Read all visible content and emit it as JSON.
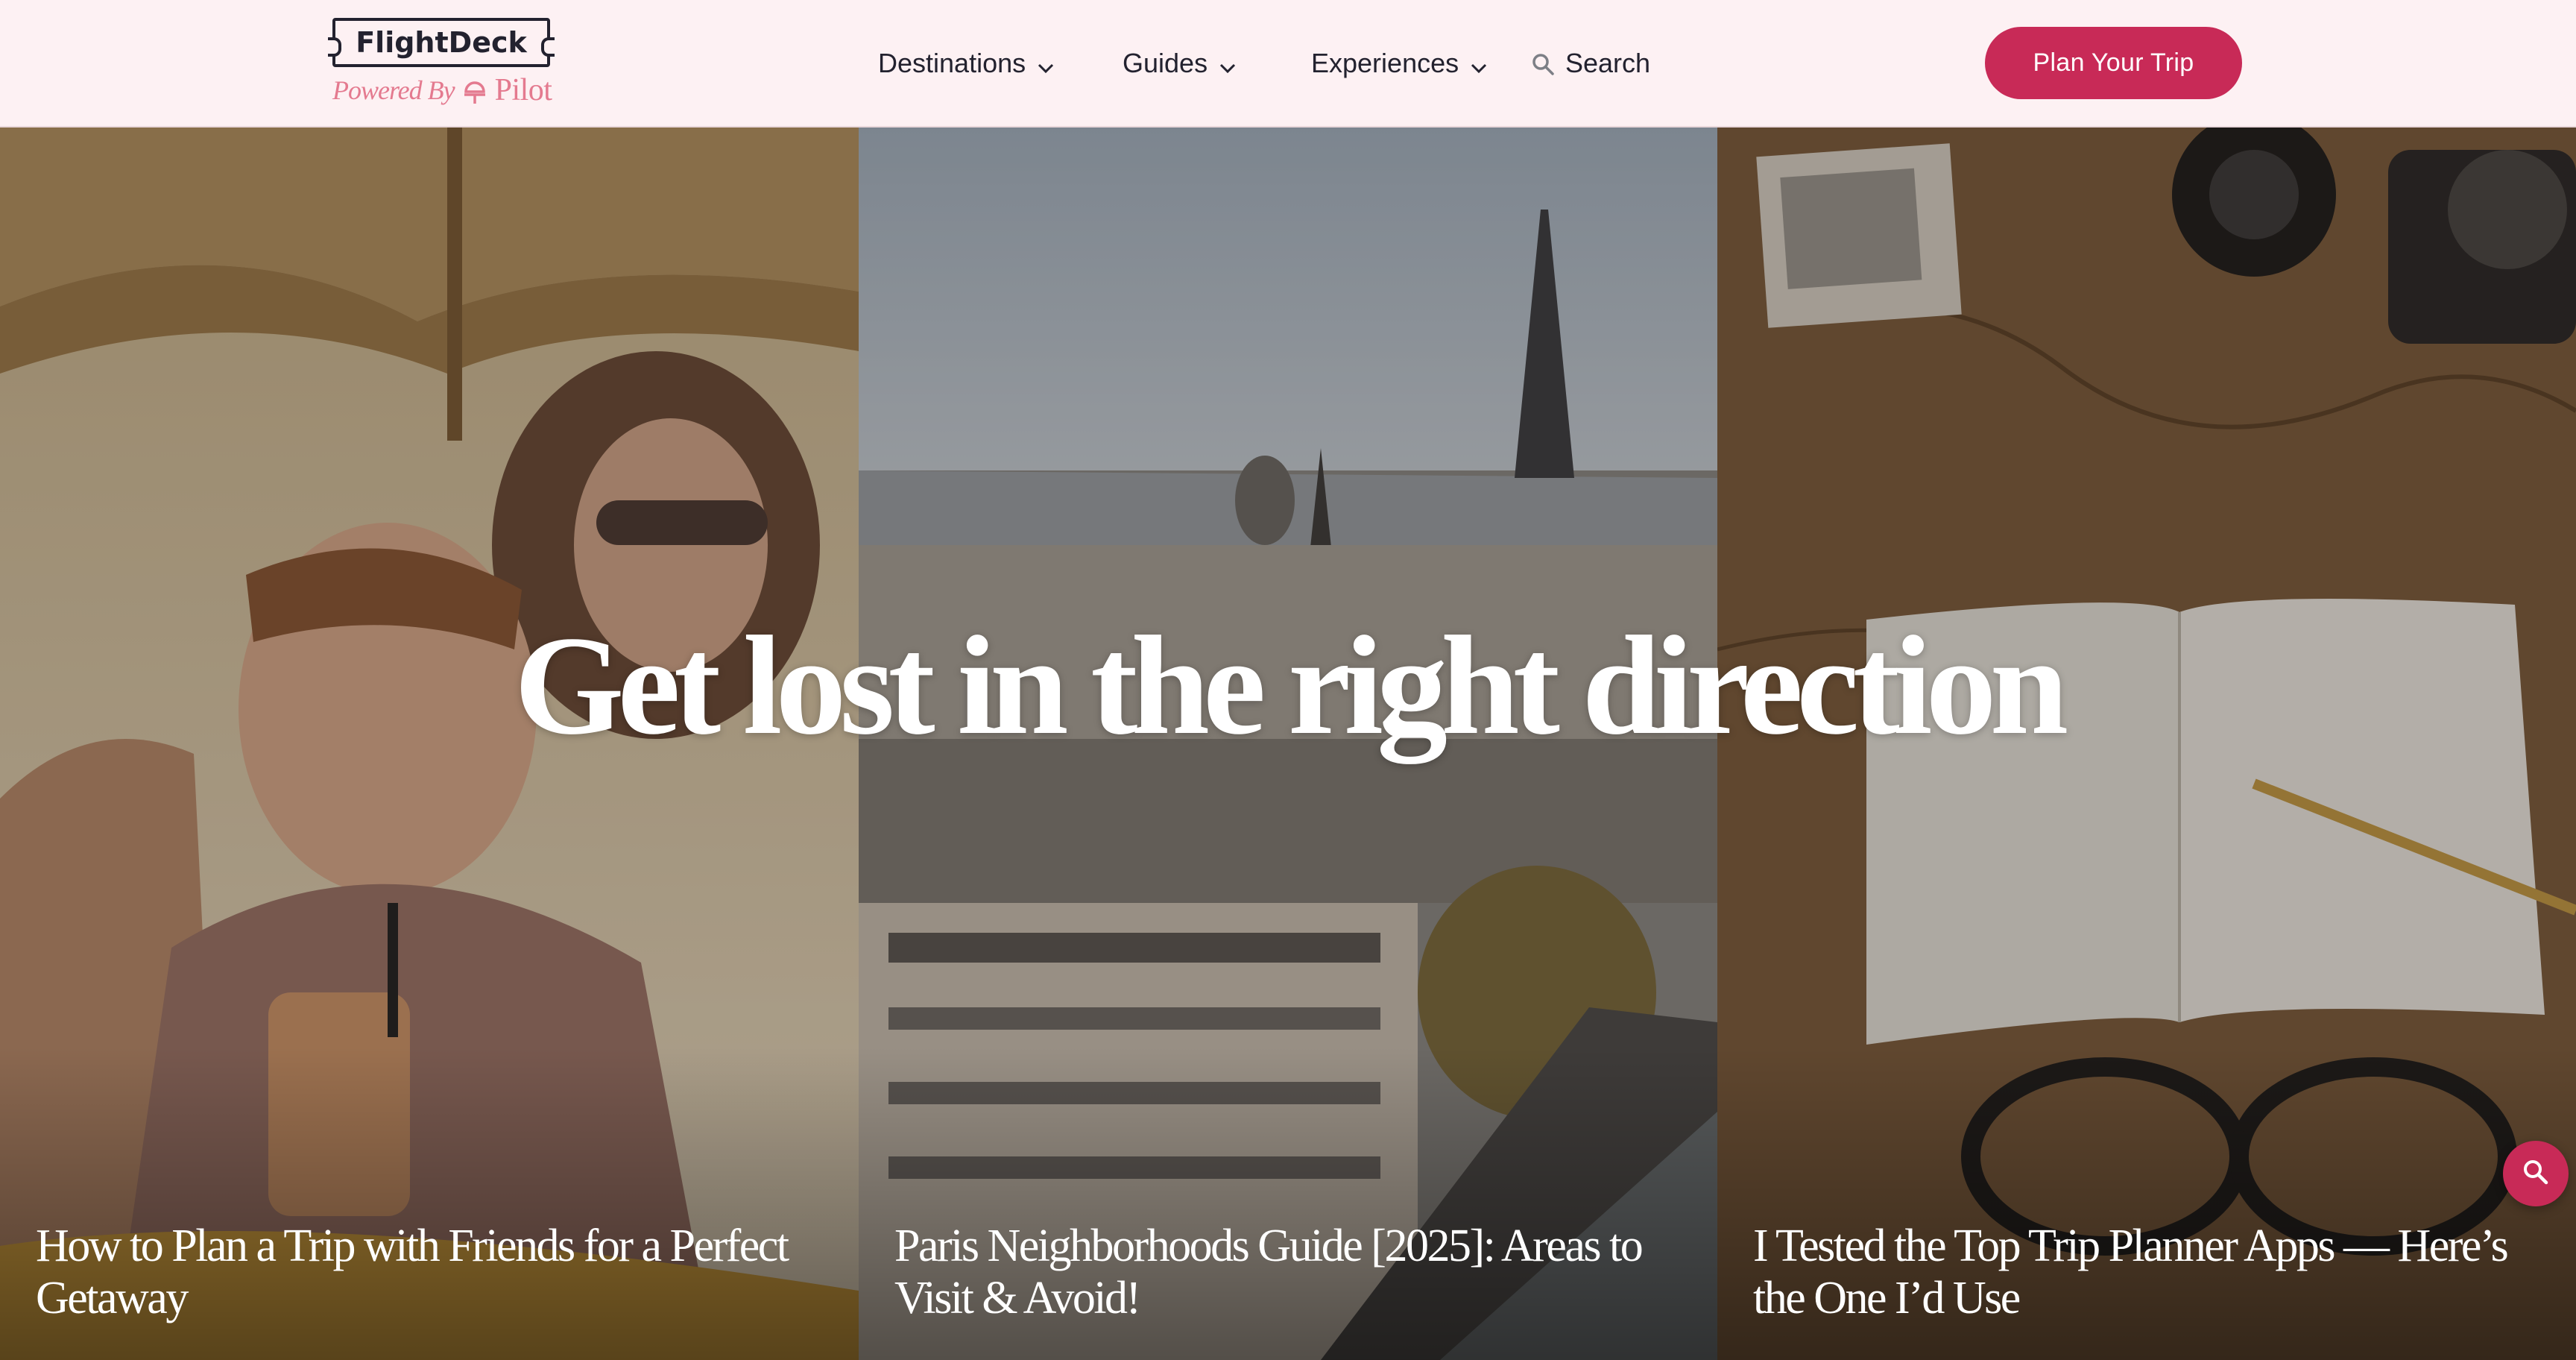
{
  "brand": {
    "name": "FlightDeck",
    "powered_by": "Powered By",
    "partner": "Pilot",
    "accent_color": "#c82a57",
    "logo_accent_color": "#e47a8f"
  },
  "nav": {
    "items": [
      {
        "label": "Destinations",
        "icon": "chevron-down-icon"
      },
      {
        "label": "Guides",
        "icon": "chevron-down-icon"
      },
      {
        "label": "Experiences",
        "icon": "chevron-down-icon"
      }
    ],
    "search_label": "Search",
    "cta_label": "Plan Your Trip"
  },
  "hero": {
    "headline": "Get lost in the right direction"
  },
  "articles": [
    {
      "title": "How to Plan a Trip with Friends for a Perfect Getaway",
      "image": "friends-drinking-cocktails"
    },
    {
      "title": "Paris Neighborhoods Guide [2025]: Areas to Visit & Avoid!",
      "image": "paris-skyline-eiffel-tower"
    },
    {
      "title": "I Tested the Top Trip Planner Apps — Here’s the One I’d Use",
      "image": "map-notebook-camera-glasses"
    }
  ],
  "floating_search": {
    "icon": "search-icon"
  }
}
